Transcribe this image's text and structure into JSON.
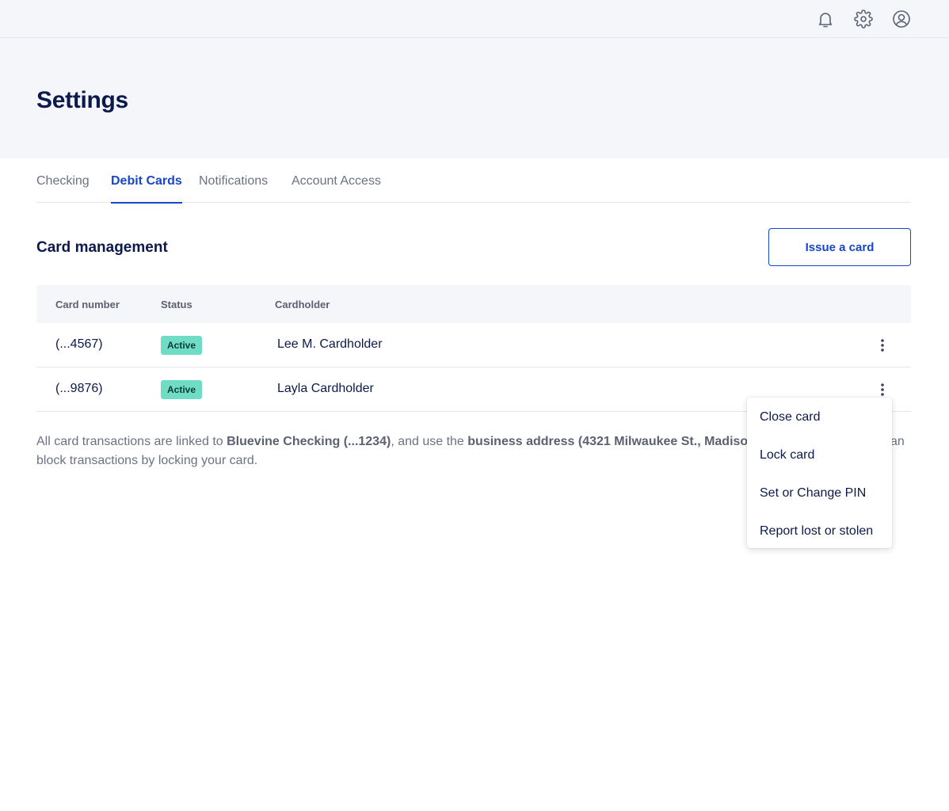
{
  "header": {
    "icons": [
      "bell-icon",
      "gear-icon",
      "user-circle-icon"
    ]
  },
  "page": {
    "title": "Settings"
  },
  "tabs": [
    {
      "label": "Checking",
      "active": false
    },
    {
      "label": "Debit Cards",
      "active": true
    },
    {
      "label": "Notifications",
      "active": false
    },
    {
      "label": "Account Access",
      "active": false
    }
  ],
  "section": {
    "title": "Card management",
    "issue_button": "Issue a card"
  },
  "table": {
    "columns": [
      "Card number",
      "Status",
      "Cardholder"
    ],
    "rows": [
      {
        "card_number": "(...4567)",
        "status": "Active",
        "cardholder": "Lee M. Cardholder"
      },
      {
        "card_number": "(...9876)",
        "status": "Active",
        "cardholder": "Layla Cardholder"
      }
    ]
  },
  "note": {
    "part1": "All card transactions are linked to ",
    "bold1": "Bluevine Checking (...1234)",
    "part2": ", and use the ",
    "bold2": "business address (4321 Milwaukee St., Madison, W",
    "part3": "",
    "tail1": "an",
    "line2": "block transactions by locking your card."
  },
  "menu": {
    "items": [
      "Close card",
      "Lock card",
      "Set or Change PIN",
      "Report lost or stolen"
    ]
  },
  "colors": {
    "accent": "#1746c7",
    "badge": "#6fdcc6",
    "header_bg": "#f4f6fa",
    "text_dark": "#0c1a4b"
  }
}
